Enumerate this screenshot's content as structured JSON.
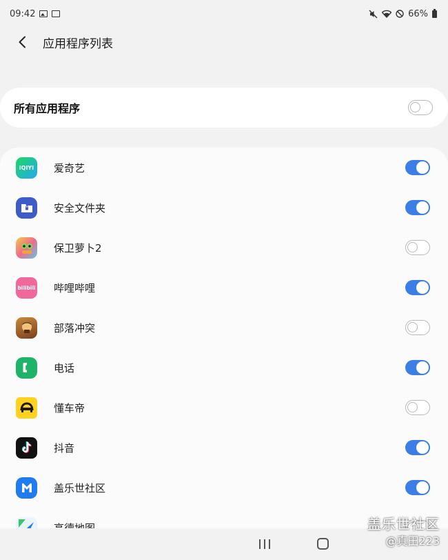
{
  "status_bar": {
    "time": "09:42",
    "battery": "66%"
  },
  "header": {
    "title": "应用程序列表"
  },
  "all_apps": {
    "label": "所有应用程序",
    "enabled": false
  },
  "apps": [
    {
      "name": "爱奇艺",
      "icon": "iqiyi-icon",
      "icon_text": "iQIYI",
      "enabled": true
    },
    {
      "name": "安全文件夹",
      "icon": "secure-folder-icon",
      "enabled": true
    },
    {
      "name": "保卫萝卜2",
      "icon": "carrot-game-icon",
      "enabled": false
    },
    {
      "name": "哔哩哔哩",
      "icon": "bilibili-icon",
      "icon_text": "bilibili",
      "enabled": true
    },
    {
      "name": "部落冲突",
      "icon": "clash-of-clans-icon",
      "enabled": false
    },
    {
      "name": "电话",
      "icon": "phone-icon",
      "enabled": true
    },
    {
      "name": "懂车帝",
      "icon": "dongchedi-icon",
      "enabled": false
    },
    {
      "name": "抖音",
      "icon": "douyin-icon",
      "enabled": true
    },
    {
      "name": "盖乐世社区",
      "icon": "galaxy-community-icon",
      "enabled": true
    },
    {
      "name": "高德地图",
      "icon": "amap-icon",
      "enabled": false
    }
  ],
  "watermark": {
    "line1": "盖乐世社区",
    "line2": "@真田223"
  },
  "colors": {
    "accent": "#3d7ee6",
    "background": "#f2f2f2"
  }
}
